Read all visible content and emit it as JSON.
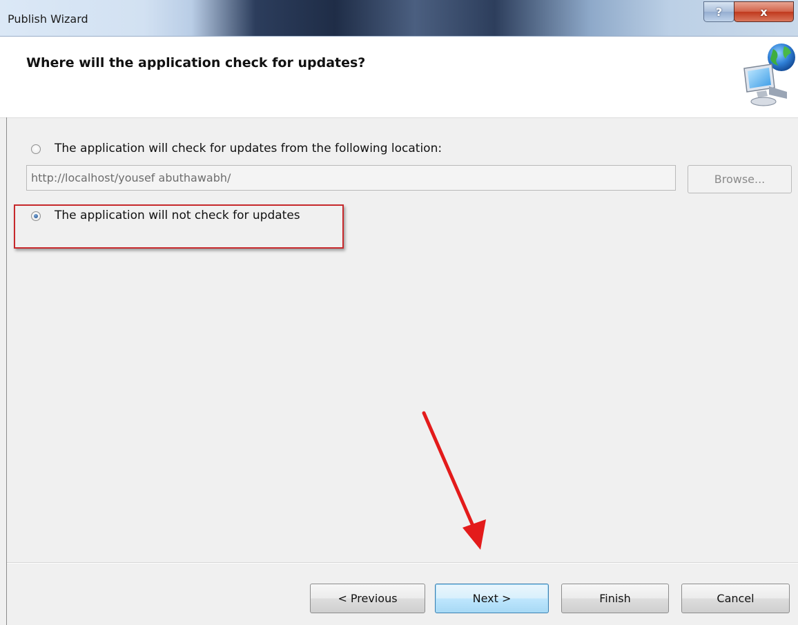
{
  "window": {
    "title": "Publish Wizard",
    "help_glyph": "?",
    "close_glyph": "x"
  },
  "header": {
    "title": "Where will the application check for updates?",
    "icon": "network-computer-globe-icon"
  },
  "options": {
    "check_location": {
      "label": "The application will check for updates from the following location:",
      "selected": false
    },
    "url": {
      "value": "http://localhost/yousef abuthawabh/"
    },
    "browse_label": "Browse...",
    "no_check": {
      "label": "The application will not check for updates",
      "selected": true
    }
  },
  "buttons": {
    "previous": "< Previous",
    "next": "Next >",
    "finish": "Finish",
    "cancel": "Cancel"
  },
  "annotations": {
    "highlight_color": "#c7282b",
    "arrow_color": "#e31b1b"
  }
}
